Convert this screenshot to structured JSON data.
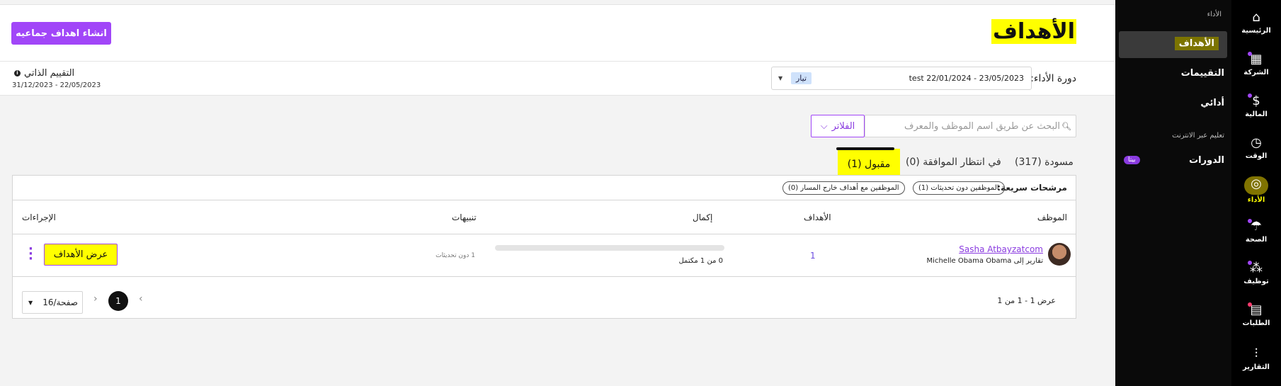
{
  "header": {
    "title": "الأهداف",
    "create_button": "انشاء اهداف جماعيه"
  },
  "perf": {
    "cycle_label": "دورة الأداء:",
    "cycle_value": "test  22/01/2024 - 23/05/2023",
    "cycle_tag": "تيار",
    "self_title": "التقييم الذاتي",
    "self_dates": "31/12/2023 - 22/05/2023"
  },
  "search": {
    "placeholder": "البحث عن طريق اسم الموظف والمعرف",
    "filter_label": "الفلاتر"
  },
  "tabs": {
    "draft": "مسودة (317)",
    "pending": "في انتظار الموافقة (0)",
    "accepted": "مقبول (1)"
  },
  "quick": {
    "label": "مرشحات سريعة:",
    "chip1": "الموظفين دون تحديثات (1)",
    "chip2": "الموظفين مع أهداف خارج المسار (0)"
  },
  "table": {
    "headers": {
      "employee": "الموظف",
      "goals": "الأهداف",
      "completion": "إكمال",
      "alerts": "تنبيهات",
      "actions": "الإجراءات"
    },
    "rows": [
      {
        "name": "Sasha Atbayzatcom",
        "reports": "تقارير إلى Michelle Obama Obama",
        "goals": "1",
        "progress": 0,
        "completion": "0 من 1 مكتمل",
        "alerts": "1 دون تحديثات",
        "action": "عرض الأهداف"
      }
    ]
  },
  "pagination": {
    "count": "عرض 1 - 1 من 1",
    "page": "1",
    "per_page": "16/صفحة"
  },
  "subnav": {
    "cat_performance": "الأداء",
    "goals": "الأهداف",
    "reviews": "التقييمات",
    "my_performance": "أدائي",
    "cat_learning": "تعليم عبر الانترنت",
    "courses": "الدورات",
    "beta": "بيتا"
  },
  "mainnav": [
    {
      "label": "الرئيسية",
      "icon": "home-icon"
    },
    {
      "label": "الشركة",
      "icon": "building-icon"
    },
    {
      "label": "المالية",
      "icon": "dollar-icon"
    },
    {
      "label": "الوقت",
      "icon": "clock-icon"
    },
    {
      "label": "الأداء",
      "icon": "target-icon"
    },
    {
      "label": "الصحة",
      "icon": "umbrella-icon"
    },
    {
      "label": "توظيف",
      "icon": "people-icon"
    },
    {
      "label": "الطلبات",
      "icon": "document-icon"
    },
    {
      "label": "التقارير",
      "icon": "chart-icon"
    }
  ],
  "colors": {
    "accent": "#a146f8",
    "highlight": "#ffff00",
    "sidebar": "#000000"
  }
}
